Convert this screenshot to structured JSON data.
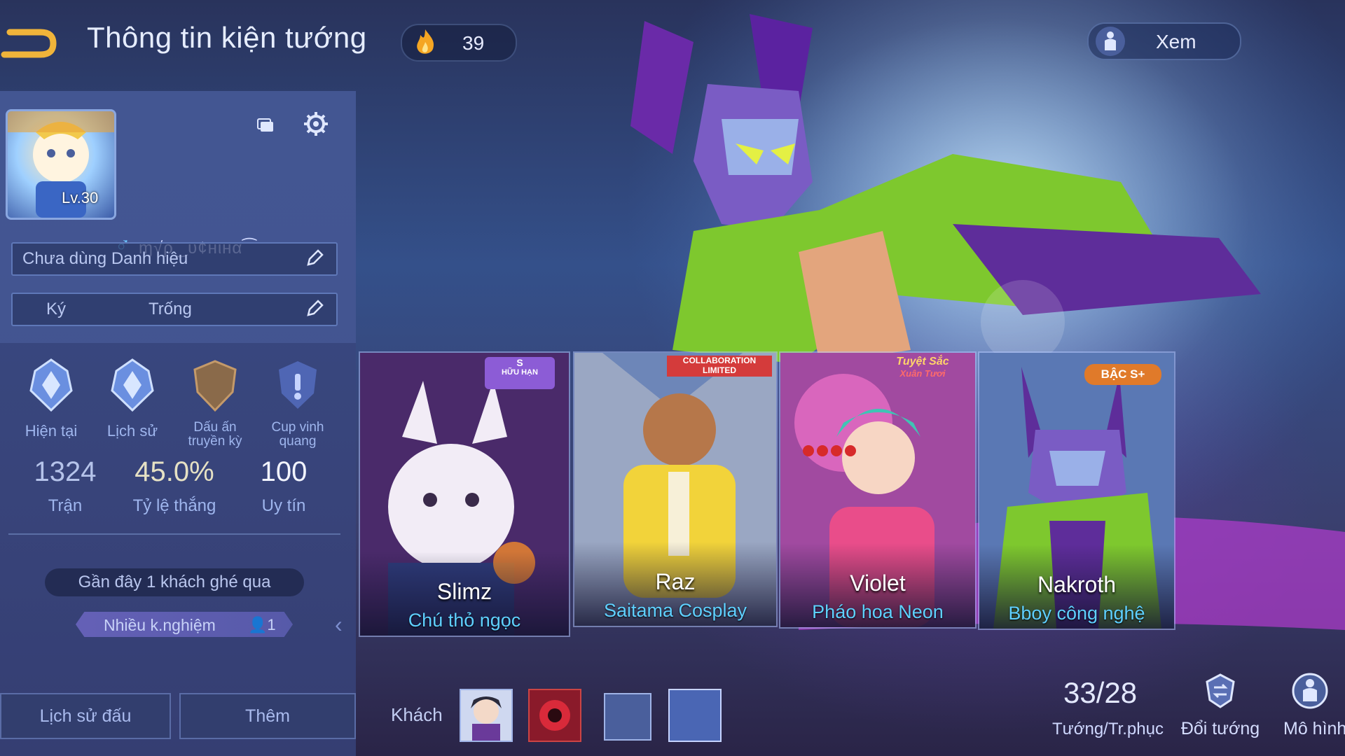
{
  "header": {
    "title": "Thông tin kiện tướng",
    "fire_count": "39",
    "view_label": "Xem"
  },
  "profile": {
    "level": "Lv.30",
    "name": "ɱ√ρ‿υ¢нιнα⁀",
    "title_field": "Chưa dùng Danh hiệu",
    "sign_label": "Ký",
    "sign_value": "Trống"
  },
  "badges": [
    {
      "label": "Hiện tại"
    },
    {
      "label": "Lịch sử"
    },
    {
      "label_line1": "Dấu ấn",
      "label_line2": "truyền kỳ"
    },
    {
      "label_line1": "Cup vinh",
      "label_line2": "quang"
    }
  ],
  "stats": [
    {
      "value": "1324",
      "label": "Trận"
    },
    {
      "value": "45.0%",
      "label": "Tỷ lệ thắng"
    },
    {
      "value": "100",
      "label": "Uy tín"
    }
  ],
  "visitors": {
    "recent": "Gần đây 1 khách ghé qua",
    "exp_label": "Nhiều k.nghiệm",
    "exp_count": "1"
  },
  "bottom_buttons": {
    "history": "Lịch sử đấu",
    "more": "Thêm"
  },
  "cards": [
    {
      "hero": "Slimz",
      "skin": "Chú thỏ ngọc",
      "tag_line1": "S",
      "tag_line2": "HỮU HẠN",
      "accent": "#8c5cd6"
    },
    {
      "hero": "Raz",
      "skin": "Saitama Cosplay",
      "tag_line1": "COLLABORATION",
      "tag_line2": "LIMITED",
      "accent": "#d43b3b"
    },
    {
      "hero": "Violet",
      "skin": "Pháo hoa Neon",
      "tag_line1": "Tuyệt Sắc",
      "tag_line2": "Xuân Tươi",
      "accent": "#e35aa8"
    },
    {
      "hero": "Nakroth",
      "skin": "Bboy công nghệ",
      "tag_line1": "BẬC S+",
      "tag_line2": "",
      "accent": "#e07a2a"
    }
  ],
  "guests": {
    "label": "Khách"
  },
  "collection": {
    "count": "33/28",
    "label": "Tướng/Tr.phục"
  },
  "actions": {
    "change_hero": "Đổi tướng",
    "model": "Mô hình"
  },
  "colors": {
    "accent_blue": "#5fd0ff",
    "panel": "#3a4a82"
  }
}
